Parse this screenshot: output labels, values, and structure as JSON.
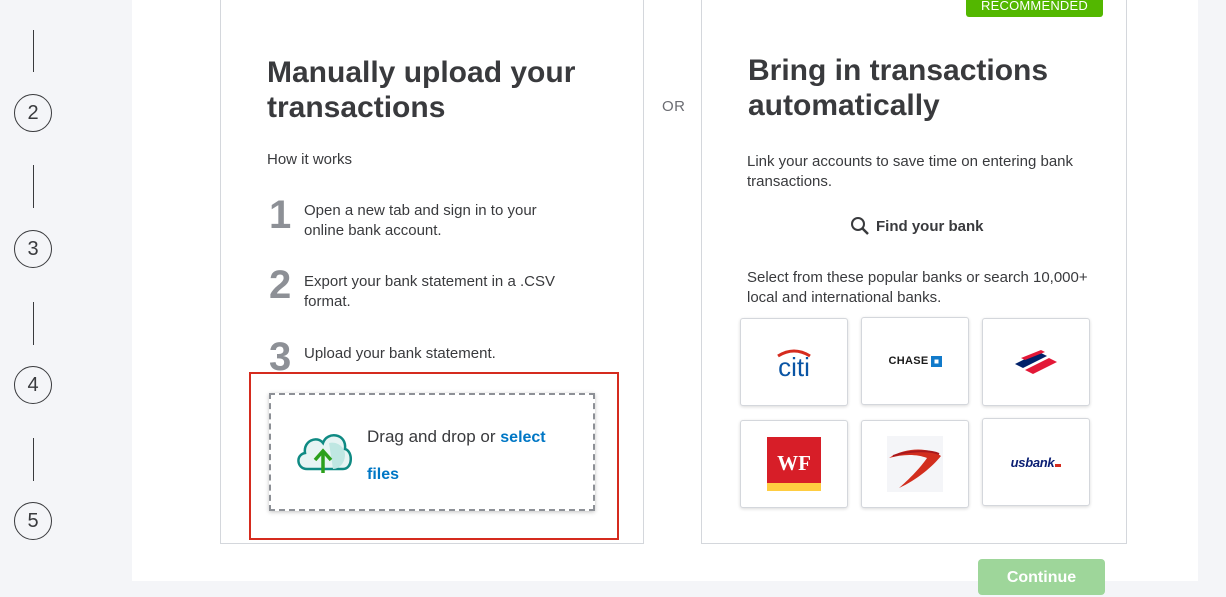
{
  "steps_rail": {
    "steps": [
      "2",
      "3",
      "4",
      "5"
    ]
  },
  "separator": "OR",
  "manual": {
    "title": "Manually upload your transactions",
    "how_it_works": "How it works",
    "steps": [
      {
        "number": "1",
        "text": "Open a new tab and sign in to your online bank account."
      },
      {
        "number": "2",
        "text": "Export your bank statement in a .CSV format."
      },
      {
        "number": "3",
        "text": "Upload your bank statement."
      }
    ],
    "dropzone": {
      "text": "Drag and drop or",
      "link": "select files",
      "icon": "cloud-upload-icon"
    }
  },
  "automatic": {
    "badge": "RECOMMENDED",
    "title": "Bring in transactions automatically",
    "description": "Link your accounts to save time on entering bank transactions.",
    "find_bank": "Find your bank",
    "popular_text": "Select from these popular banks or search 10,000+ local and international banks.",
    "banks": [
      {
        "name": "citi",
        "logo_text": "citi"
      },
      {
        "name": "chase",
        "logo_text": "CHASE"
      },
      {
        "name": "bank-of-america",
        "logo_text": ""
      },
      {
        "name": "wells-fargo",
        "logo_text": "WF"
      },
      {
        "name": "capital-one",
        "logo_text": ""
      },
      {
        "name": "us-bank",
        "logo_text": "usbank"
      }
    ]
  },
  "footer": {
    "continue_label": "Continue"
  },
  "colors": {
    "accent_green": "#53b700",
    "link_blue": "#0077c5",
    "highlight_red": "#d52b1e",
    "continue_disabled": "#9ed69a"
  }
}
